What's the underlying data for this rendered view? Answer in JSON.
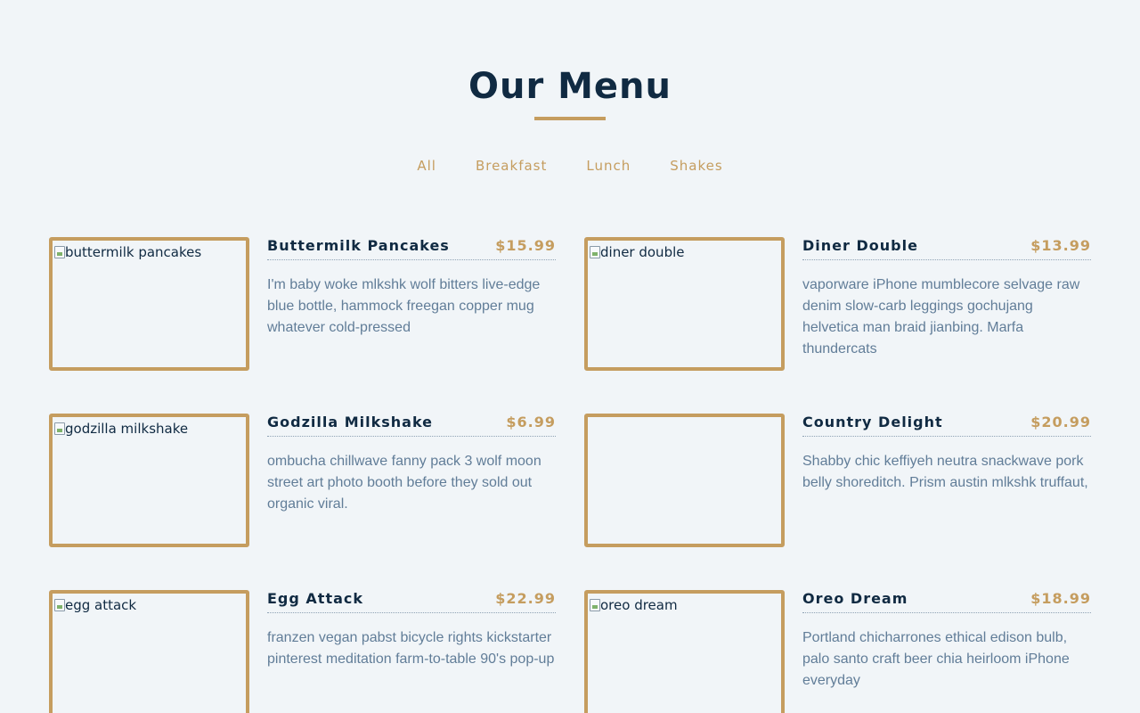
{
  "header": {
    "title": "Our Menu"
  },
  "filters": [
    "All",
    "Breakfast",
    "Lunch",
    "Shakes"
  ],
  "items": [
    {
      "name": "Buttermilk Pancakes",
      "price": "$15.99",
      "alt": "buttermilk pancakes",
      "desc": "I'm baby woke mlkshk wolf bitters live-edge blue bottle, hammock freegan copper mug whatever cold-pressed"
    },
    {
      "name": "Diner Double",
      "price": "$13.99",
      "alt": "diner double",
      "desc": "vaporware iPhone mumblecore selvage raw denim slow-carb leggings gochujang helvetica man braid jianbing. Marfa thundercats"
    },
    {
      "name": "Godzilla Milkshake",
      "price": "$6.99",
      "alt": "godzilla milkshake",
      "desc": "ombucha chillwave fanny pack 3 wolf moon street art photo booth before they sold out organic viral."
    },
    {
      "name": "Country Delight",
      "price": "$20.99",
      "alt": "",
      "desc": "Shabby chic keffiyeh neutra snackwave pork belly shoreditch. Prism austin mlkshk truffaut,"
    },
    {
      "name": "Egg Attack",
      "price": "$22.99",
      "alt": "egg attack",
      "desc": "franzen vegan pabst bicycle rights kickstarter pinterest meditation farm-to-table 90's pop-up"
    },
    {
      "name": "Oreo Dream",
      "price": "$18.99",
      "alt": "oreo dream",
      "desc": "Portland chicharrones ethical edison bulb, palo santo craft beer chia heirloom iPhone everyday"
    }
  ],
  "colors": {
    "background": "#f1f5f8",
    "primary": "#102a42",
    "accent": "#c59d5f",
    "text": "#617d98"
  }
}
